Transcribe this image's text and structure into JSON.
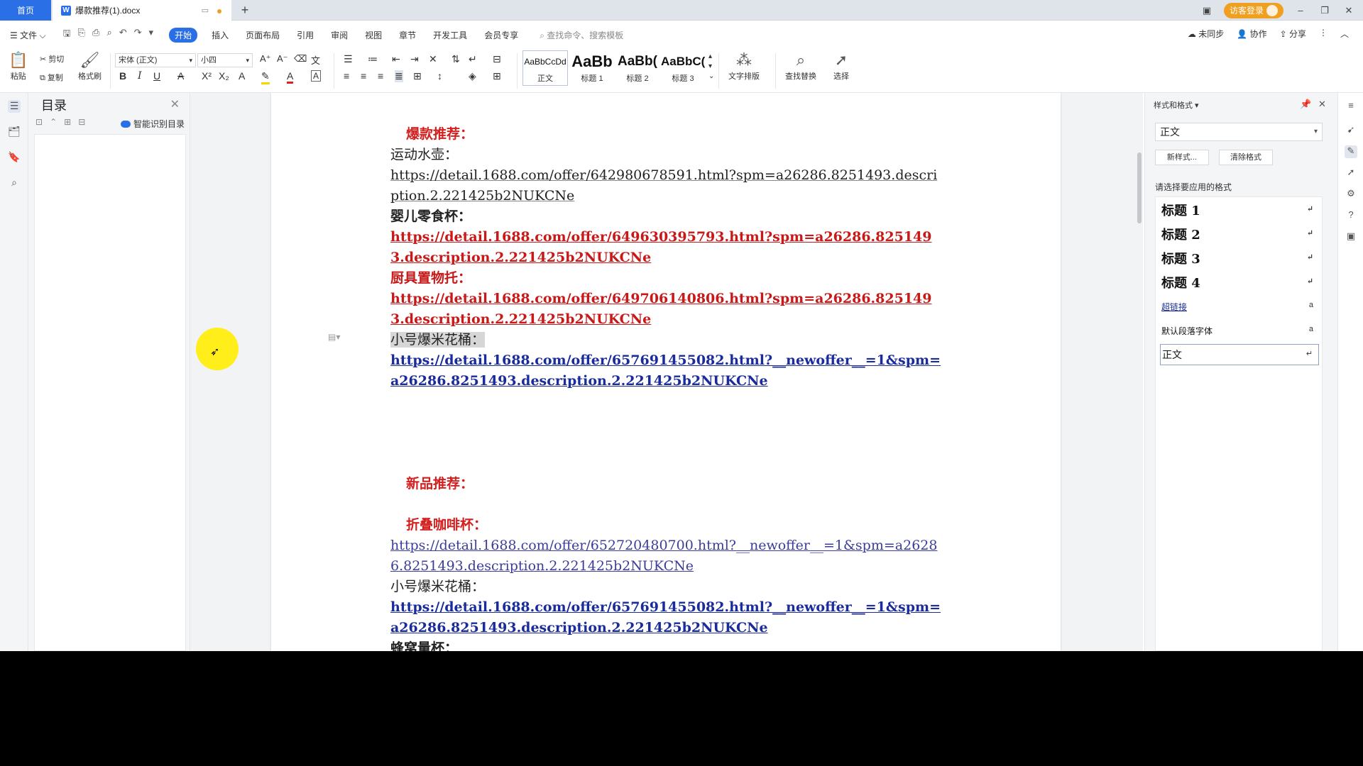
{
  "tabs": {
    "home": "首页",
    "doc_title": "爆款推荐(1).docx",
    "doc_icon_letter": "W",
    "login": "访客登录"
  },
  "menu": {
    "file": "文件",
    "items": [
      "开始",
      "插入",
      "页面布局",
      "引用",
      "审阅",
      "视图",
      "章节",
      "开发工具",
      "会员专享"
    ],
    "search": "查找命令、搜索模板",
    "sync": "未同步",
    "collab": "协作",
    "share": "分享"
  },
  "ribbon": {
    "paste": "粘贴",
    "cut": "剪切",
    "copy": "复制",
    "format_painter": "格式刷",
    "font_name": "宋体 (正文)",
    "font_size": "小四",
    "styles": [
      {
        "preview": "AaBbCcDd",
        "label": "正文"
      },
      {
        "preview": "AaBb",
        "label": "标题 1"
      },
      {
        "preview": "AaBb(",
        "label": "标题 2"
      },
      {
        "preview": "AaBbC(",
        "label": "标题 3"
      }
    ],
    "text_layout": "文字排版",
    "find_replace": "查找替换",
    "select": "选择"
  },
  "toc": {
    "title": "目录",
    "smart": "智能识别目录"
  },
  "document": {
    "hot_title": "爆款推荐：",
    "item1_name": "运动水壶：",
    "item1_link": "https://detail.1688.com/offer/642980678591.html?spm=a26286.8251493.description.2.221425b2NUKCNe",
    "item2_name": "婴儿零食杯：",
    "item2_link": "https://detail.1688.com/offer/649630395793.html?spm=a26286.8251493.description.2.221425b2NUKCNe",
    "item3_name": "厨具置物托：",
    "item3_link": "https://detail.1688.com/offer/649706140806.html?spm=a26286.8251493.description.2.221425b2NUKCNe",
    "item4_name": "小号爆米花桶：",
    "item4_link": "https://detail.1688.com/offer/657691455082.html?__newoffer__=1&spm=a26286.8251493.description.2.221425b2NUKCNe",
    "new_title": "新品推荐：",
    "new1_name": "折叠咖啡杯：",
    "new1_link": "https://detail.1688.com/offer/652720480700.html?__newoffer__=1&spm=a26286.8251493.description.2.221425b2NUKCNe",
    "new2_name": "小号爆米花桶：",
    "new2_link": "https://detail.1688.com/offer/657691455082.html?__newoffer__=1&spm=a26286.8251493.description.2.221425b2NUKCNe",
    "new3_name": "蜂窝量杯："
  },
  "style_panel": {
    "title": "样式和格式",
    "current": "正文",
    "new_style": "新样式...",
    "clear_format": "清除格式",
    "apply_label": "请选择要应用的格式",
    "items": [
      "标题 1",
      "标题 2",
      "标题 3",
      "标题 4",
      "超链接",
      "默认段落字体",
      "正文"
    ]
  }
}
